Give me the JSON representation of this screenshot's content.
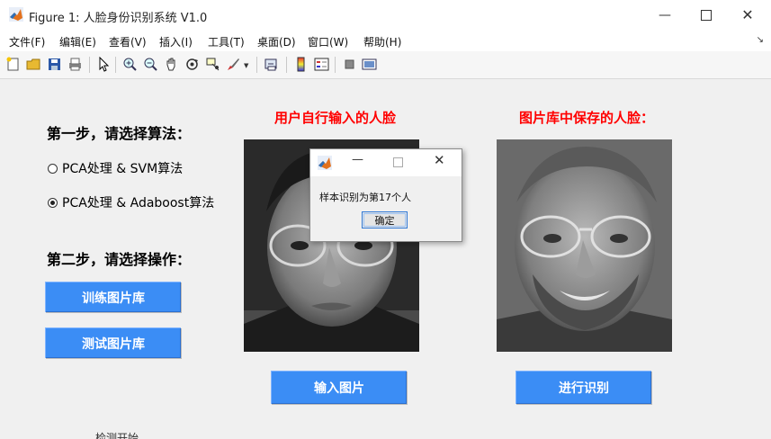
{
  "window": {
    "title": "Figure 1: 人脸身份识别系统 V1.0",
    "background_text": "检测开始..."
  },
  "menu": [
    "文件(F)",
    "编辑(E)",
    "查看(V)",
    "插入(I)",
    "工具(T)",
    "桌面(D)",
    "窗口(W)",
    "帮助(H)"
  ],
  "toolbar_icons": [
    "new-figure-icon",
    "open-file-icon",
    "save-icon",
    "print-icon",
    "pointer-icon",
    "zoom-in-icon",
    "zoom-out-icon",
    "pan-hand-icon",
    "rotate-3d-icon",
    "data-cursor-icon",
    "brush-icon",
    "link-icon",
    "colorbar-icon",
    "legend-icon",
    "hide-plot-tools-icon",
    "show-plot-tools-icon"
  ],
  "step1": {
    "label": "第一步，请选择算法：",
    "options": [
      "PCA处理 & SVM算法",
      "PCA处理 & Adaboost算法"
    ],
    "selected_index": 1
  },
  "step2": {
    "label": "第二步，请选择操作：",
    "train_button": "训练图片库",
    "test_button": "测试图片库"
  },
  "input_panel": {
    "title": "用户自行输入的人脸",
    "button": "输入图片"
  },
  "library_panel": {
    "title": "图片库中保存的人脸：",
    "button": "进行识别"
  },
  "dialog": {
    "message": "样本识别为第17个人",
    "ok_button": "确定"
  },
  "colors": {
    "button_blue": "#3b8df5",
    "title_red": "#ff0000",
    "figure_bg": "#f0f0f0"
  }
}
